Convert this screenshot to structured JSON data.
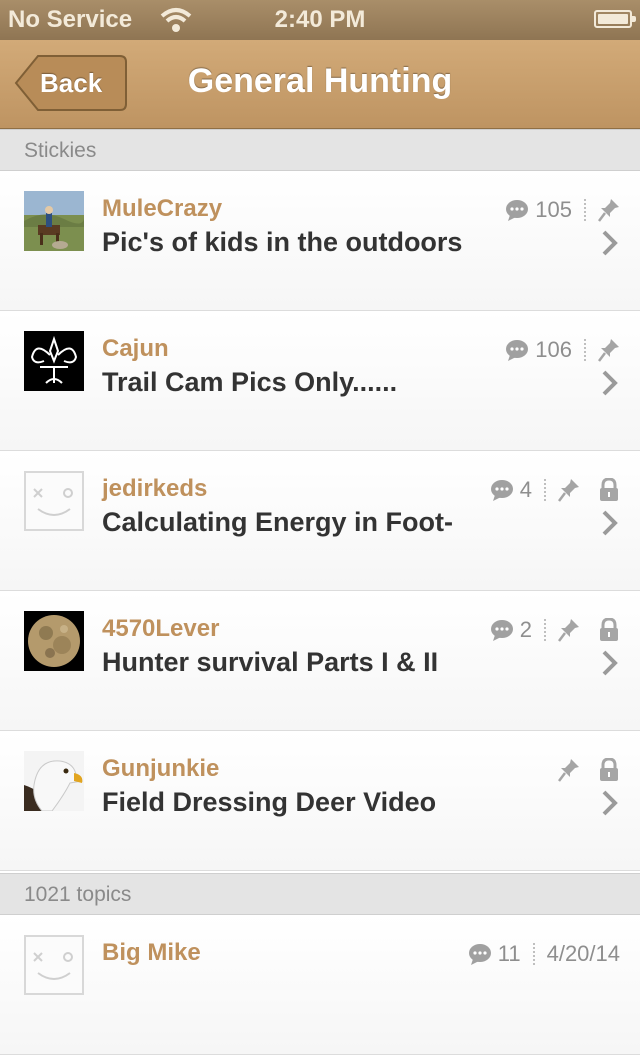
{
  "status_bar": {
    "carrier": "No Service",
    "time": "2:40 PM"
  },
  "nav": {
    "back_label": "Back",
    "title": "General Hunting"
  },
  "stickies": {
    "header": "Stickies",
    "rows": [
      {
        "author": "MuleCrazy",
        "title": "Pic's of kids in the outdoors",
        "replies": "105",
        "avatar": "photo-rider-horse",
        "pinned": true,
        "locked": false
      },
      {
        "author": "Cajun",
        "title": "Trail Cam Pics Only......",
        "replies": "106",
        "avatar": "fleur-de-lis",
        "pinned": true,
        "locked": false
      },
      {
        "author": "jedirkeds",
        "title": "Calculating Energy in Foot-",
        "replies": "4",
        "avatar": "default-face",
        "pinned": true,
        "locked": true
      },
      {
        "author": "4570Lever",
        "title": "Hunter survival Parts I & II",
        "replies": "2",
        "avatar": "moon",
        "pinned": true,
        "locked": true
      },
      {
        "author": "Gunjunkie",
        "title": "Field Dressing Deer Video",
        "replies": "",
        "avatar": "bald-eagle",
        "pinned": true,
        "locked": true
      }
    ]
  },
  "topics": {
    "header": "1021 topics",
    "first_row": {
      "author": "Big Mike",
      "replies": "11",
      "date": "4/20/14",
      "avatar": "default-face"
    }
  },
  "colors": {
    "nav_bg": "#c79c6a",
    "author": "#bf915d",
    "title": "#333333",
    "meta": "#8e8e8e"
  }
}
